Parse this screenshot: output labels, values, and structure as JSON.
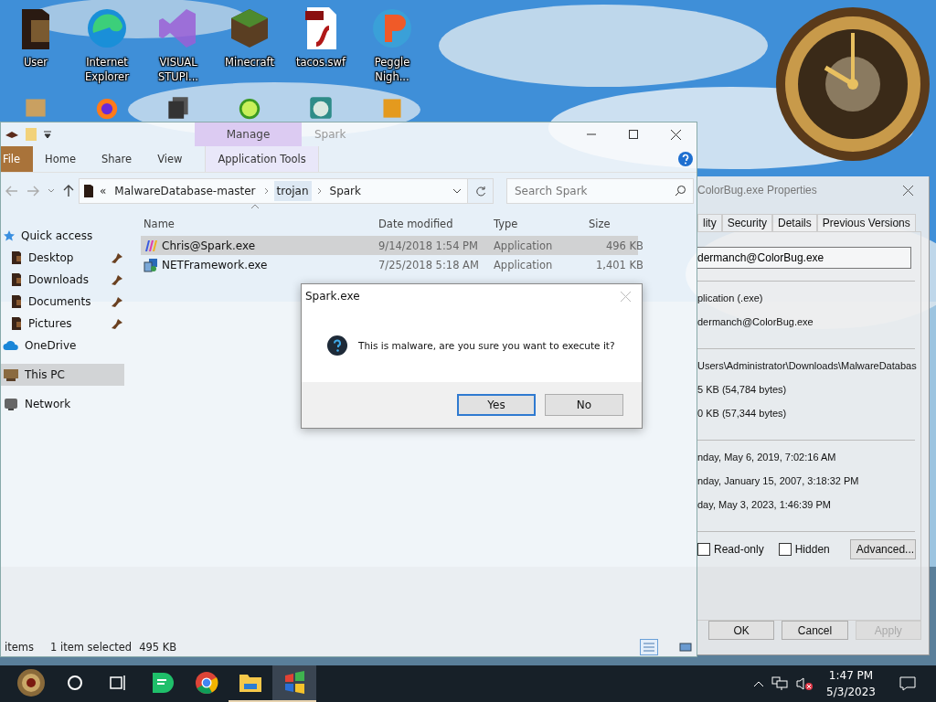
{
  "desktop_icons": [
    {
      "kind": "folder",
      "label": "User"
    },
    {
      "kind": "edge",
      "label": "Internet Explorer"
    },
    {
      "kind": "studio",
      "label": "VISUAL STUPI..."
    },
    {
      "kind": "minecraft",
      "label": "Minecraft"
    },
    {
      "kind": "flash",
      "label": "tacos.swf"
    },
    {
      "kind": "peggle",
      "label": "Peggle Nigh..."
    }
  ],
  "desktop_icons_partial": [
    {
      "kind": "scroll"
    },
    {
      "kind": "firefox"
    },
    {
      "kind": "stack"
    },
    {
      "kind": "lime"
    },
    {
      "kind": "globe"
    },
    {
      "kind": "crate"
    }
  ],
  "explorer": {
    "title": "Spark",
    "context_group": "Manage",
    "ribbon_tabs": [
      {
        "kind": "file",
        "label": "File",
        "selected": false
      },
      {
        "kind": "tab",
        "label": "Home",
        "selected": false
      },
      {
        "kind": "tab",
        "label": "Share",
        "selected": false
      },
      {
        "kind": "tab",
        "label": "View",
        "selected": false
      },
      {
        "kind": "context",
        "label": "Application Tools",
        "selected": false
      }
    ],
    "address": {
      "overflow": "«",
      "crumbs": [
        "MalwareDatabase-master",
        "trojan",
        "Spark"
      ]
    },
    "search": {
      "placeholder": "Search Spark"
    },
    "nav": [
      {
        "kind": "star",
        "label": "Quick access",
        "selected": false,
        "children": [
          {
            "kind": "folder",
            "label": "Desktop",
            "selected": false,
            "pinned": true
          },
          {
            "kind": "folder",
            "label": "Downloads",
            "selected": false,
            "pinned": true
          },
          {
            "kind": "folder",
            "label": "Documents",
            "selected": false,
            "pinned": true
          },
          {
            "kind": "folder",
            "label": "Pictures",
            "selected": false,
            "pinned": true
          }
        ]
      },
      {
        "kind": "cloud",
        "label": "OneDrive",
        "selected": false
      },
      {
        "kind": "pc",
        "label": "This PC",
        "selected": true
      },
      {
        "kind": "network",
        "label": "Network",
        "selected": false
      }
    ],
    "columns": [
      "Name",
      "Date modified",
      "Type",
      "Size"
    ],
    "rows": [
      {
        "kind": "colorful",
        "name": "Chris@Spark.exe",
        "date": "9/14/2018 1:54 PM",
        "type": "Application",
        "size": "496 KB",
        "selected": true
      },
      {
        "kind": "installer",
        "name": "NETFramework.exe",
        "date": "7/25/2018 5:18 AM",
        "type": "Application",
        "size": "1,401 KB",
        "selected": false
      }
    ],
    "status": [
      "items",
      "1 item selected",
      "495 KB"
    ],
    "views": [
      {
        "kind": "details",
        "selected": true
      },
      {
        "kind": "tiles",
        "selected": false
      }
    ]
  },
  "properties": {
    "title": "ColorBug.exe Properties",
    "tabs": [
      {
        "label": "lity",
        "selected": false
      },
      {
        "label": "Security",
        "selected": false
      },
      {
        "label": "Details",
        "selected": false
      },
      {
        "label": "Previous Versions",
        "selected": false
      }
    ],
    "name_value": "dermanch@ColorBug.exe",
    "sections": [
      [
        "plication (.exe)",
        "dermanch@ColorBug.exe"
      ],
      [
        "Users\\Administrator\\Downloads\\MalwareDatabas",
        "5 KB (54,784 bytes)",
        "0 KB (57,344 bytes)"
      ],
      [
        "nday, May 6, 2019, 7:02:16 AM",
        "nday, January 15, 2007, 3:18:32 PM",
        "day, May 3, 2023, 1:46:39 PM"
      ]
    ],
    "attributes": [
      {
        "label": "Read-only",
        "checked": false
      },
      {
        "label": "Hidden",
        "checked": false
      }
    ],
    "advanced": "Advanced...",
    "buttons": [
      {
        "label": "OK",
        "disabled": false
      },
      {
        "label": "Cancel",
        "disabled": false
      },
      {
        "label": "Apply",
        "disabled": true
      }
    ]
  },
  "dialog": {
    "title": "Spark.exe",
    "message": "This is malware, are you sure you want to execute it?",
    "buttons": [
      {
        "label": "Yes",
        "default": true
      },
      {
        "label": "No",
        "default": false
      }
    ]
  },
  "taskbar": {
    "items": [
      {
        "kind": "start",
        "running": false,
        "active": false
      },
      {
        "kind": "search",
        "running": false,
        "active": false
      },
      {
        "kind": "taskview",
        "running": false,
        "active": false
      },
      {
        "kind": "chat",
        "running": false,
        "active": false
      },
      {
        "kind": "chrome",
        "running": false,
        "active": false
      },
      {
        "kind": "explorer",
        "running": true,
        "active": false
      },
      {
        "kind": "flag",
        "running": true,
        "active": true
      }
    ],
    "time": "1:47 PM",
    "date": "5/3/2023"
  }
}
